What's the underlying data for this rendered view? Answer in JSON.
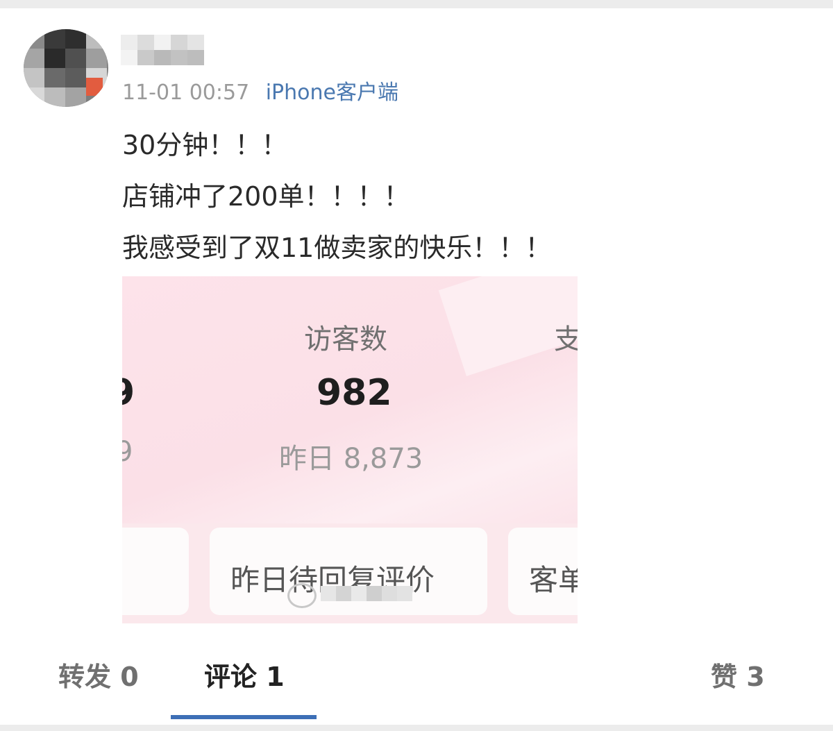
{
  "post": {
    "time": "11-01 00:57",
    "source": "iPhone客户端",
    "lines": [
      "30分钟！！！",
      "店铺冲了200单！！！！",
      "我感受到了双11做卖家的快乐！！！"
    ]
  },
  "image": {
    "label": "访客数",
    "label_partial": "支",
    "value": "982",
    "value_partial": "9",
    "sub": "昨日 8,873",
    "sub_partial": "9",
    "card_label": "昨日待回复评价",
    "card_label_partial": "客单"
  },
  "tabs": {
    "repost": "转发 0",
    "comment": "评论 1",
    "like": "赞 3"
  },
  "colors": {
    "accent": "#3d6fb6",
    "source": "#4a78b0"
  }
}
